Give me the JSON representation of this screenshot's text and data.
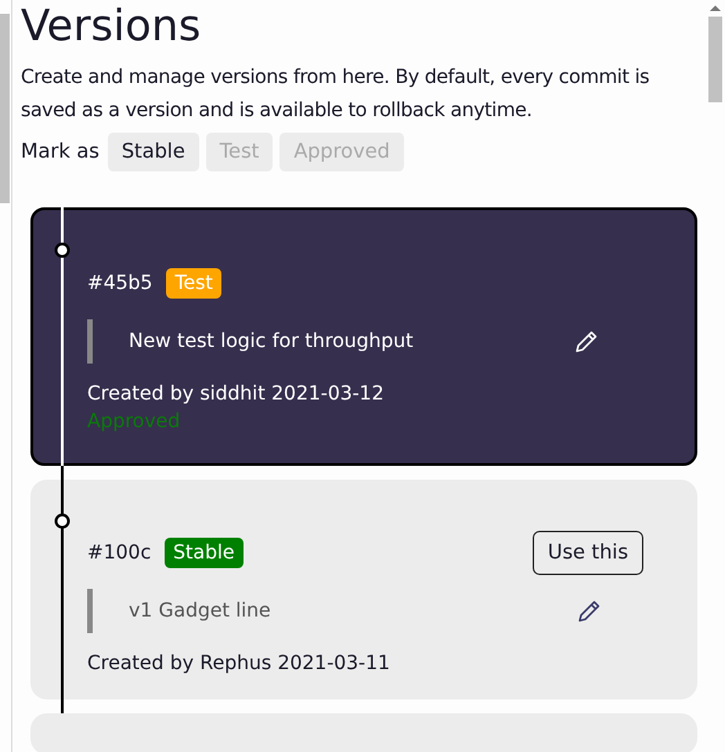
{
  "title": "Versions",
  "description": "Create and manage versions from here. By default, every commit is saved as a version and is available to rollback anytime.",
  "mark_as": {
    "label": "Mark as",
    "buttons": [
      {
        "label": "Stable",
        "disabled": false
      },
      {
        "label": "Test",
        "disabled": true
      },
      {
        "label": "Approved",
        "disabled": true
      }
    ]
  },
  "versions": [
    {
      "hash": "#45b5",
      "tag": "Test",
      "color": "#ffa500",
      "message": "New test logic for throughput",
      "created": "Created by siddhit 2021-03-12",
      "status": "Approved",
      "selected": true
    },
    {
      "hash": "#100c",
      "tag": "Stable",
      "color": "#008000",
      "message": "v1 Gadget line",
      "created": "Created by Rephus 2021-03-11",
      "action": "Use this",
      "selected": false
    }
  ]
}
